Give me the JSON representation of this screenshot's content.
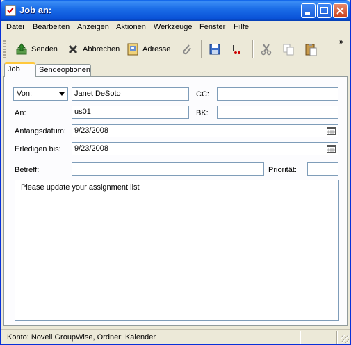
{
  "window": {
    "title": "Job an:"
  },
  "menu": [
    "Datei",
    "Bearbeiten",
    "Anzeigen",
    "Aktionen",
    "Werkzeuge",
    "Fenster",
    "Hilfe"
  ],
  "toolbar": {
    "send_label": "Senden",
    "cancel_label": "Abbrechen",
    "address_label": "Adresse",
    "more": "»"
  },
  "tabs": [
    "Job",
    "Sendeoptionen"
  ],
  "form": {
    "from_select": "Von:",
    "from_value": "Janet DeSoto",
    "cc_label": "CC:",
    "cc_value": "",
    "to_label": "An:",
    "to_value": "us01",
    "bc_label": "BK:",
    "bc_value": "",
    "start_label": "Anfangsdatum:",
    "start_value": "9/23/2008",
    "due_label": "Erledigen bis:",
    "due_value": "9/23/2008",
    "subject_label": "Betreff:",
    "subject_value": "",
    "priority_label": "Priorität:",
    "priority_value": "",
    "message": "Please update your assignment list"
  },
  "status": {
    "text": "Konto: Novell GroupWise,  Ordner: Kalender"
  }
}
